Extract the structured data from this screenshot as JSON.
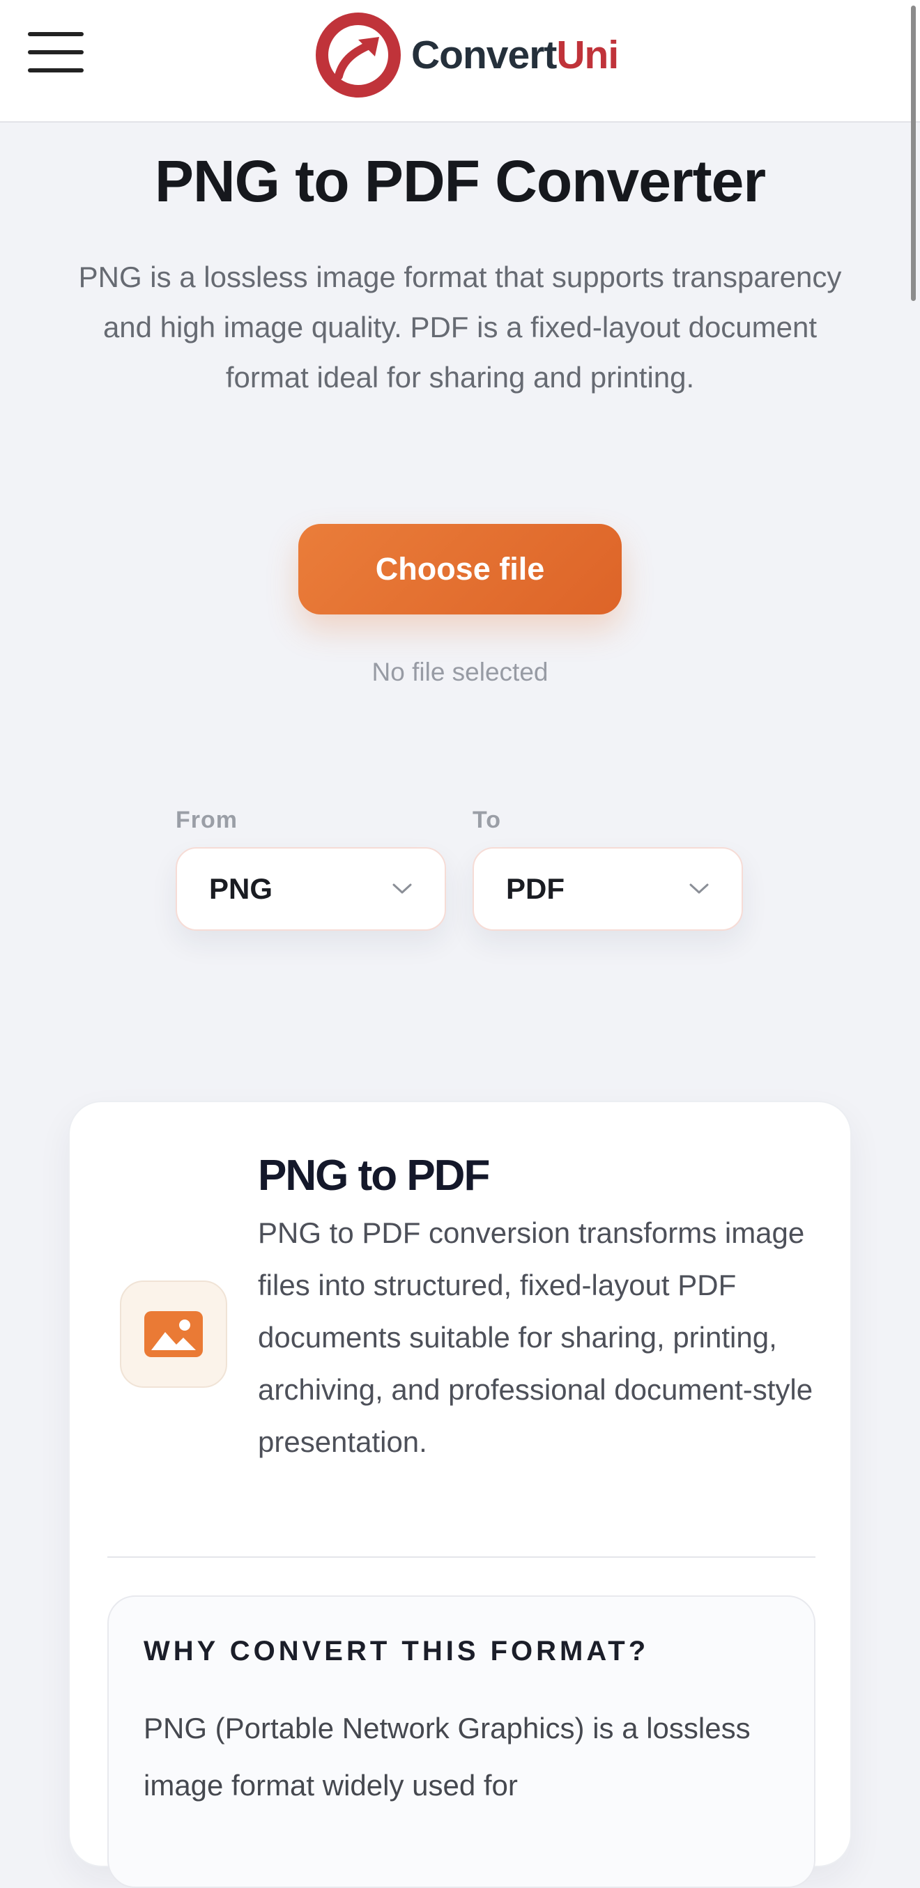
{
  "header": {
    "logo_prefix": "Convert",
    "logo_suffix": "Uni",
    "menu_icon": "hamburger-menu-icon",
    "brand_colors": {
      "dark": "#25303b",
      "red": "#c0333a"
    }
  },
  "hero": {
    "title": "PNG to PDF Converter",
    "description": "PNG is a lossless image format that supports transparency and high image quality. PDF is a fixed-layout document format ideal for sharing and printing."
  },
  "upload": {
    "button_label": "Choose file",
    "status": "No file selected",
    "accent_color": "#e4702f"
  },
  "converter": {
    "from_label": "From",
    "from_value": "PNG",
    "to_label": "To",
    "to_value": "PDF"
  },
  "info_card": {
    "icon": "image-icon",
    "title": "PNG to PDF",
    "description": "PNG to PDF conversion transforms image files into structured, fixed-layout PDF documents suitable for sharing, printing, archiving, and professional document-style presentation.",
    "why_title": "WHY CONVERT THIS FORMAT?",
    "why_text": "PNG (Portable Network Graphics) is a lossless image format widely used for"
  }
}
